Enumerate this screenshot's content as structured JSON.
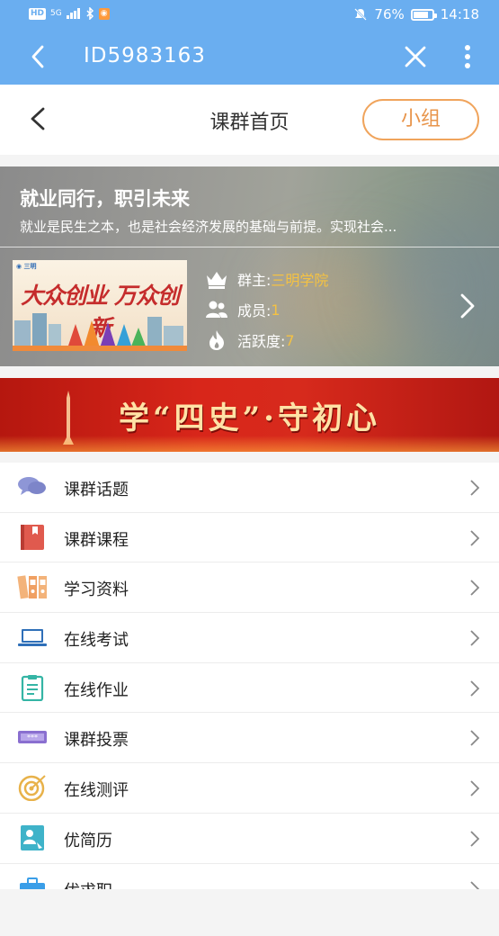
{
  "status_bar": {
    "hd": "HD",
    "signal": "5G",
    "battery": "76%",
    "time": "14:18"
  },
  "browser": {
    "title": "ID5983163"
  },
  "header": {
    "title": "课群首页",
    "group_button": "小组"
  },
  "group": {
    "title": "就业同行，职引未来",
    "description": "就业是民生之本，也是社会经济发展的基础与前提。实现社会...",
    "poster_slogan": "大众创业 万众创新",
    "owner_label": "群主:",
    "owner_value": "三明学院",
    "members_label": "成员:",
    "members_value": "1",
    "activity_label": "活跃度:",
    "activity_value": "7"
  },
  "banner": {
    "text": "学“四史”·守初心"
  },
  "menu": [
    {
      "label": "课群话题",
      "icon": "chat-bubbles-icon"
    },
    {
      "label": "课群课程",
      "icon": "book-icon"
    },
    {
      "label": "学习资料",
      "icon": "binders-icon"
    },
    {
      "label": "在线考试",
      "icon": "laptop-icon"
    },
    {
      "label": "在线作业",
      "icon": "clipboard-icon"
    },
    {
      "label": "课群投票",
      "icon": "ticket-icon"
    },
    {
      "label": "在线测评",
      "icon": "target-icon"
    },
    {
      "label": "优简历",
      "icon": "resume-icon"
    },
    {
      "label": "优求职",
      "icon": "briefcase-icon"
    }
  ],
  "colors": {
    "status_bar_bg": "#6aaef0",
    "accent_orange": "#e8944a",
    "meta_value": "#f5c242"
  }
}
